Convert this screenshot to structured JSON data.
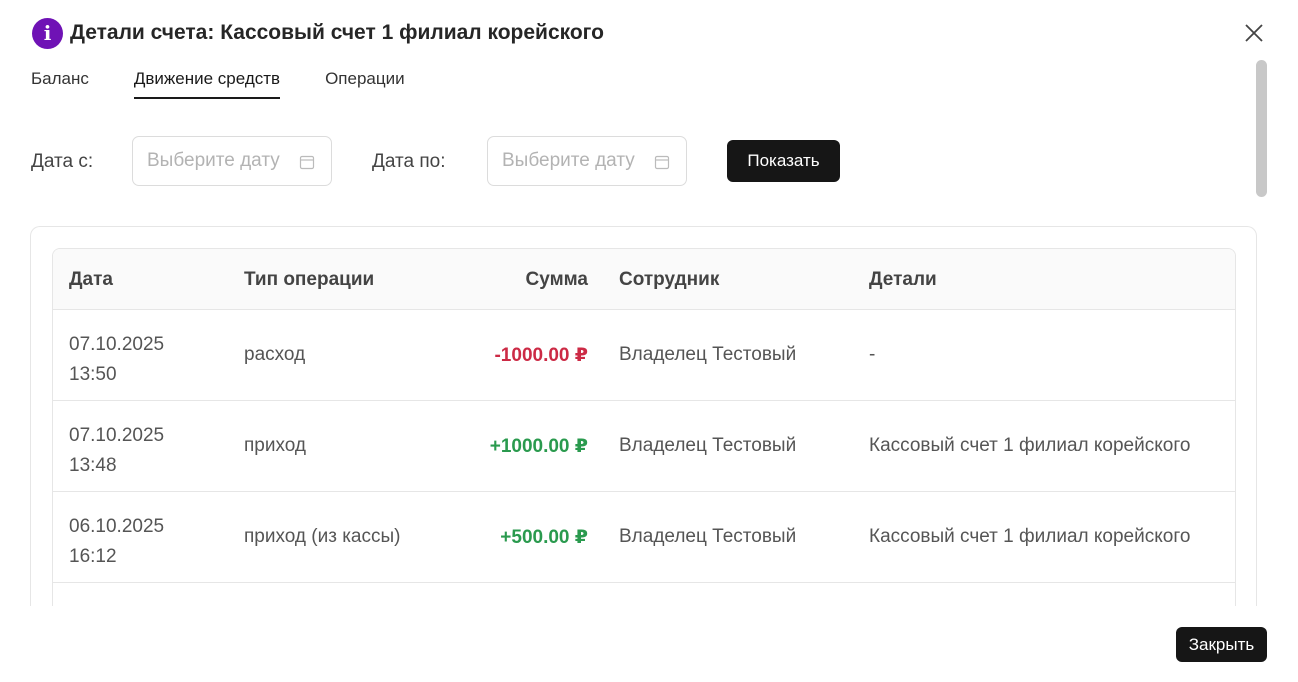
{
  "dialog": {
    "title": "Детали счета: Кассовый счет 1 филиал корейского",
    "icon": "info-icon",
    "accent": "#6f12b5"
  },
  "tabs": [
    {
      "label": "Баланс",
      "active": false
    },
    {
      "label": "Движение средств",
      "active": true
    },
    {
      "label": "Операции",
      "active": false
    }
  ],
  "filters": {
    "from_label": "Дата с:",
    "to_label": "Дата по:",
    "from_placeholder": "Выберите дату",
    "to_placeholder": "Выберите дату",
    "show_label": "Показать"
  },
  "table": {
    "columns": [
      "Дата",
      "Тип операции",
      "Сумма",
      "Сотрудник",
      "Детали"
    ],
    "rows": [
      {
        "date": "07.10.2025 13:50",
        "type": "расход",
        "amount": "-1000.00 ₽",
        "sign": "negative",
        "employee": "Владелец Тестовый",
        "details": "-"
      },
      {
        "date": "07.10.2025 13:48",
        "type": "приход",
        "amount": "+1000.00 ₽",
        "sign": "positive",
        "employee": "Владелец Тестовый",
        "details": "Кассовый счет 1 филиал корейского"
      },
      {
        "date": "06.10.2025 16:12",
        "type": "приход (из кассы)",
        "amount": "+500.00 ₽",
        "sign": "positive",
        "employee": "Владелец Тестовый",
        "details": "Кассовый счет 1 филиал корейского"
      }
    ]
  },
  "colors": {
    "negative": "#cc2a45",
    "positive": "#2a9a4e",
    "button": "#161616"
  },
  "footer": {
    "close_label": "Закрыть"
  }
}
